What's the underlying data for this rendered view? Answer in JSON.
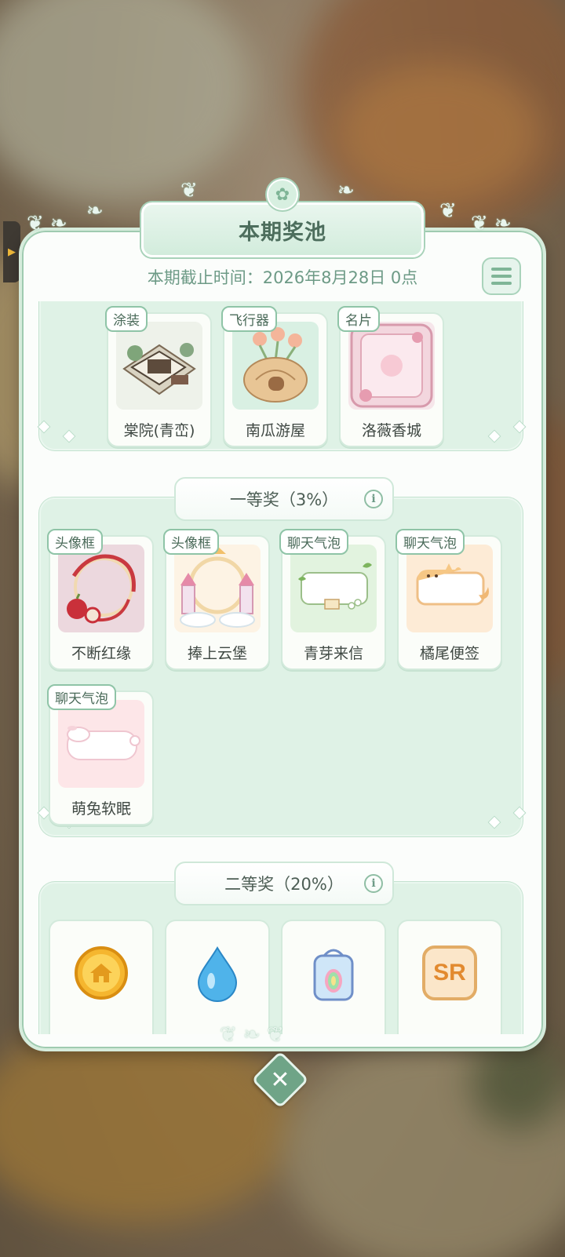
{
  "title": "本期奖池",
  "deadline": "本期截止时间：2026年8月28日 0点",
  "colors": {
    "accent": "#6fa487",
    "panel_bg": "#fbfdfb",
    "section_bg": "#dff2e6",
    "text_dark": "#3f4843"
  },
  "top_prizes": [
    {
      "tag": "涂装",
      "name": "棠院(青峦)",
      "icon": "house-courtyard-image"
    },
    {
      "tag": "飞行器",
      "name": "南瓜游屋",
      "icon": "pumpkin-house-image"
    },
    {
      "tag": "名片",
      "name": "洛薇香城",
      "icon": "rose-card-image"
    }
  ],
  "first_prize": {
    "title": "一等奖（3%）",
    "items": [
      {
        "tag": "头像框",
        "name": "不断红缘",
        "icon": "apple-frame-image"
      },
      {
        "tag": "头像框",
        "name": "捧上云堡",
        "icon": "castle-frame-image"
      },
      {
        "tag": "聊天气泡",
        "name": "青芽来信",
        "icon": "sprout-bubble-image"
      },
      {
        "tag": "聊天气泡",
        "name": "橘尾便签",
        "icon": "cat-bubble-image"
      },
      {
        "tag": "聊天气泡",
        "name": "萌兔软眠",
        "icon": "bunny-bubble-image"
      }
    ]
  },
  "second_prize": {
    "title": "二等奖（20%）",
    "items": [
      {
        "icon": "gold-coin-icon"
      },
      {
        "icon": "water-drop-icon"
      },
      {
        "icon": "rainbow-egg-box-icon"
      },
      {
        "icon": "sr-badge-icon",
        "label": "SR"
      }
    ]
  }
}
